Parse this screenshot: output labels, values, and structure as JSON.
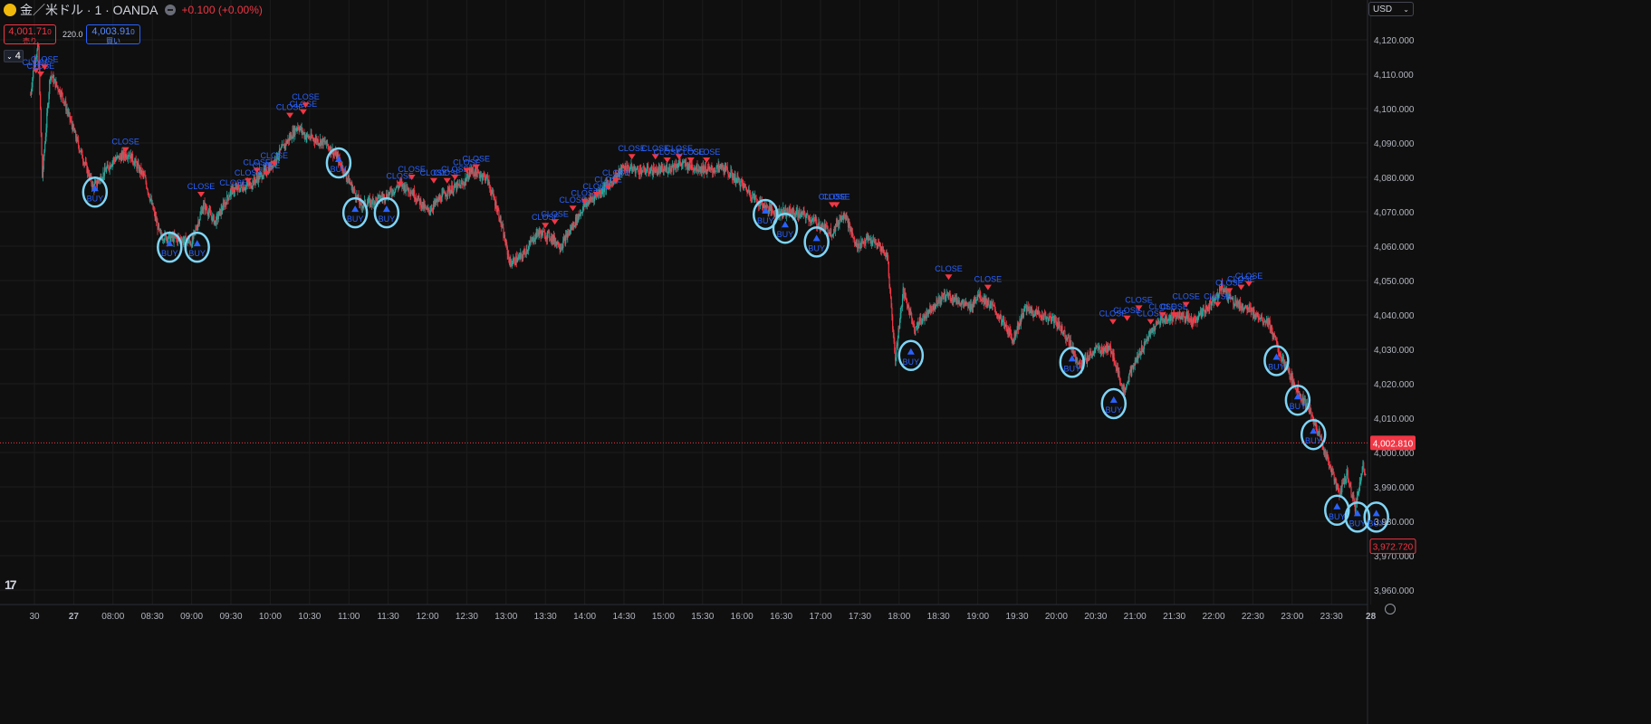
{
  "header": {
    "symbol_title": "金／米ドル · 1 · OANDA",
    "change_text": "+0.100 (+0.00%)",
    "sell_price": "4,001.71",
    "sell_sup": "0",
    "sell_label": "売り",
    "spread": "220.0",
    "buy_price": "4,003.91",
    "buy_sup": "0",
    "buy_label": "買い",
    "indicator_count": "4",
    "currency": "USD"
  },
  "colors": {
    "background": "#0f0f0f",
    "up": "#26a69a",
    "down": "#f23645",
    "grid": "#1c1c1c",
    "buy_marker": "#2962ff",
    "close_marker": "#f23645",
    "highlight": "#7fd4f5"
  },
  "chart_data": {
    "type": "candlestick",
    "y_ticks": [
      "4,120.000",
      "4,110.000",
      "4,100.000",
      "4,090.000",
      "4,080.000",
      "4,070.000",
      "4,060.000",
      "4,050.000",
      "4,040.000",
      "4,030.000",
      "4,020.000",
      "4,010.000",
      "4,000.000",
      "3,990.000",
      "3,980.000",
      "3,970.000",
      "3,960.000"
    ],
    "y_tick_values": [
      4120,
      4110,
      4100,
      4090,
      4080,
      4070,
      4060,
      4050,
      4040,
      4030,
      4020,
      4010,
      4000,
      3990,
      3980,
      3970,
      3960
    ],
    "ylim": [
      3958,
      4125
    ],
    "x_tick_labels": [
      "30",
      "27",
      "08:00",
      "08:30",
      "09:00",
      "09:30",
      "10:00",
      "10:30",
      "11:00",
      "11:30",
      "12:00",
      "12:30",
      "13:00",
      "13:30",
      "14:00",
      "14:30",
      "15:00",
      "15:30",
      "16:00",
      "16:30",
      "17:00",
      "17:30",
      "18:00",
      "18:30",
      "19:00",
      "19:30",
      "20:00",
      "20:30",
      "21:00",
      "21:30",
      "22:00",
      "22:30",
      "23:00",
      "23:30",
      "28"
    ],
    "x_tick_hours": [
      7.0,
      7.5,
      8.0,
      8.5,
      9.0,
      9.5,
      10.0,
      10.5,
      11.0,
      11.5,
      12.0,
      12.5,
      13.0,
      13.5,
      14.0,
      14.5,
      15.0,
      15.5,
      16.0,
      16.5,
      17.0,
      17.5,
      18.0,
      18.5,
      19.0,
      19.5,
      20.0,
      20.5,
      21.0,
      21.5,
      22.0,
      22.5,
      23.0,
      23.5,
      24.0
    ],
    "series_path": [
      [
        6.95,
        4104
      ],
      [
        7.0,
        4114
      ],
      [
        7.05,
        4118
      ],
      [
        7.1,
        4080
      ],
      [
        7.2,
        4110
      ],
      [
        7.35,
        4104
      ],
      [
        7.55,
        4090
      ],
      [
        7.75,
        4077
      ],
      [
        8.0,
        4085
      ],
      [
        8.2,
        4087
      ],
      [
        8.4,
        4080
      ],
      [
        8.6,
        4063
      ],
      [
        8.85,
        4062
      ],
      [
        9.0,
        4061
      ],
      [
        9.15,
        4072
      ],
      [
        9.3,
        4067
      ],
      [
        9.5,
        4076
      ],
      [
        9.75,
        4078
      ],
      [
        10.0,
        4083
      ],
      [
        10.2,
        4090
      ],
      [
        10.35,
        4095
      ],
      [
        10.45,
        4092
      ],
      [
        10.7,
        4090
      ],
      [
        10.85,
        4086
      ],
      [
        11.0,
        4079
      ],
      [
        11.15,
        4072
      ],
      [
        11.3,
        4073
      ],
      [
        11.5,
        4075
      ],
      [
        11.65,
        4078
      ],
      [
        11.8,
        4076
      ],
      [
        12.0,
        4070
      ],
      [
        12.25,
        4076
      ],
      [
        12.45,
        4078
      ],
      [
        12.55,
        4082
      ],
      [
        12.75,
        4080
      ],
      [
        12.9,
        4070
      ],
      [
        13.05,
        4055
      ],
      [
        13.2,
        4057
      ],
      [
        13.4,
        4064
      ],
      [
        13.55,
        4063
      ],
      [
        13.7,
        4060
      ],
      [
        13.85,
        4066
      ],
      [
        14.0,
        4072
      ],
      [
        14.2,
        4076
      ],
      [
        14.35,
        4079
      ],
      [
        14.5,
        4083
      ],
      [
        14.7,
        4082
      ],
      [
        15.0,
        4082
      ],
      [
        15.2,
        4084
      ],
      [
        15.4,
        4083
      ],
      [
        15.6,
        4082
      ],
      [
        15.75,
        4083
      ],
      [
        16.0,
        4078
      ],
      [
        16.2,
        4073
      ],
      [
        16.4,
        4070
      ],
      [
        16.6,
        4070
      ],
      [
        16.8,
        4069
      ],
      [
        17.0,
        4066
      ],
      [
        17.15,
        4064
      ],
      [
        17.3,
        4070
      ],
      [
        17.45,
        4060
      ],
      [
        17.6,
        4062
      ],
      [
        17.75,
        4060
      ],
      [
        17.85,
        4057
      ],
      [
        17.95,
        4027
      ],
      [
        18.05,
        4047
      ],
      [
        18.2,
        4036
      ],
      [
        18.4,
        4042
      ],
      [
        18.6,
        4046
      ],
      [
        18.75,
        4044
      ],
      [
        18.9,
        4042
      ],
      [
        19.0,
        4046
      ],
      [
        19.2,
        4042
      ],
      [
        19.45,
        4033
      ],
      [
        19.6,
        4042
      ],
      [
        19.8,
        4040
      ],
      [
        20.0,
        4038
      ],
      [
        20.15,
        4033
      ],
      [
        20.3,
        4025
      ],
      [
        20.5,
        4030
      ],
      [
        20.7,
        4030
      ],
      [
        20.85,
        4018
      ],
      [
        21.0,
        4026
      ],
      [
        21.15,
        4033
      ],
      [
        21.3,
        4038
      ],
      [
        21.55,
        4040
      ],
      [
        21.75,
        4038
      ],
      [
        21.95,
        4043
      ],
      [
        22.1,
        4048
      ],
      [
        22.25,
        4044
      ],
      [
        22.4,
        4042
      ],
      [
        22.55,
        4040
      ],
      [
        22.7,
        4038
      ],
      [
        22.85,
        4028
      ],
      [
        23.0,
        4021
      ],
      [
        23.15,
        4015
      ],
      [
        23.3,
        4008
      ],
      [
        23.45,
        3998
      ],
      [
        23.6,
        3988
      ],
      [
        23.7,
        3994
      ],
      [
        23.8,
        3984
      ],
      [
        23.9,
        3996
      ],
      [
        24.05,
        3988
      ],
      [
        24.2,
        3983
      ],
      [
        24.3,
        3977
      ],
      [
        24.35,
        3972.72
      ]
    ],
    "current_price_label": "4,002.810",
    "current_price": 4002.81,
    "last_price_label": "3,972.720",
    "last_price": 3972.72,
    "buy_label": "BUY",
    "close_label": "CLOSE",
    "buy_markers": [
      {
        "t": 7.77,
        "p": 4076.5,
        "highlighted": true
      },
      {
        "t": 8.72,
        "p": 4060.5,
        "highlighted": true
      },
      {
        "t": 9.07,
        "p": 4060.5,
        "highlighted": true
      },
      {
        "t": 10.87,
        "p": 4085,
        "highlighted": true
      },
      {
        "t": 11.08,
        "p": 4070.5,
        "highlighted": true
      },
      {
        "t": 11.48,
        "p": 4070.5,
        "highlighted": true
      },
      {
        "t": 16.3,
        "p": 4070,
        "highlighted": true
      },
      {
        "t": 16.55,
        "p": 4066,
        "highlighted": true
      },
      {
        "t": 16.95,
        "p": 4062,
        "highlighted": true
      },
      {
        "t": 18.15,
        "p": 4029,
        "highlighted": true
      },
      {
        "t": 20.2,
        "p": 4027,
        "highlighted": true
      },
      {
        "t": 20.73,
        "p": 4015,
        "highlighted": true
      },
      {
        "t": 22.8,
        "p": 4027.5,
        "highlighted": true
      },
      {
        "t": 23.07,
        "p": 4016,
        "highlighted": true
      },
      {
        "t": 23.27,
        "p": 4006,
        "highlighted": true
      },
      {
        "t": 23.57,
        "p": 3984,
        "highlighted": true
      },
      {
        "t": 23.83,
        "p": 3982,
        "highlighted": true
      },
      {
        "t": 24.07,
        "p": 3982,
        "highlighted": true
      }
    ],
    "close_markers": [
      [
        7.02,
        4111
      ],
      [
        7.08,
        4110
      ],
      [
        7.13,
        4112
      ],
      [
        8.16,
        4088
      ],
      [
        9.12,
        4075
      ],
      [
        9.53,
        4076
      ],
      [
        9.72,
        4079
      ],
      [
        9.83,
        4082
      ],
      [
        9.95,
        4081
      ],
      [
        10.05,
        4084
      ],
      [
        10.25,
        4098
      ],
      [
        10.42,
        4099
      ],
      [
        10.45,
        4101
      ],
      [
        11.65,
        4078
      ],
      [
        11.8,
        4080
      ],
      [
        12.08,
        4079
      ],
      [
        12.25,
        4079
      ],
      [
        12.35,
        4080
      ],
      [
        12.5,
        4082
      ],
      [
        12.62,
        4083
      ],
      [
        13.5,
        4066
      ],
      [
        13.62,
        4067
      ],
      [
        13.85,
        4071
      ],
      [
        14.0,
        4073
      ],
      [
        14.15,
        4075
      ],
      [
        14.3,
        4077
      ],
      [
        14.4,
        4079
      ],
      [
        14.6,
        4086
      ],
      [
        14.9,
        4086
      ],
      [
        15.05,
        4085
      ],
      [
        15.2,
        4086
      ],
      [
        15.35,
        4085
      ],
      [
        15.55,
        4085
      ],
      [
        17.15,
        4072
      ],
      [
        17.2,
        4072
      ],
      [
        18.63,
        4051
      ],
      [
        19.13,
        4048
      ],
      [
        20.72,
        4038
      ],
      [
        20.9,
        4039
      ],
      [
        21.05,
        4042
      ],
      [
        21.2,
        4038
      ],
      [
        21.35,
        4040
      ],
      [
        21.5,
        4040
      ],
      [
        21.65,
        4043
      ],
      [
        22.05,
        4043
      ],
      [
        22.2,
        4047
      ],
      [
        22.35,
        4048
      ],
      [
        22.45,
        4049
      ]
    ]
  }
}
